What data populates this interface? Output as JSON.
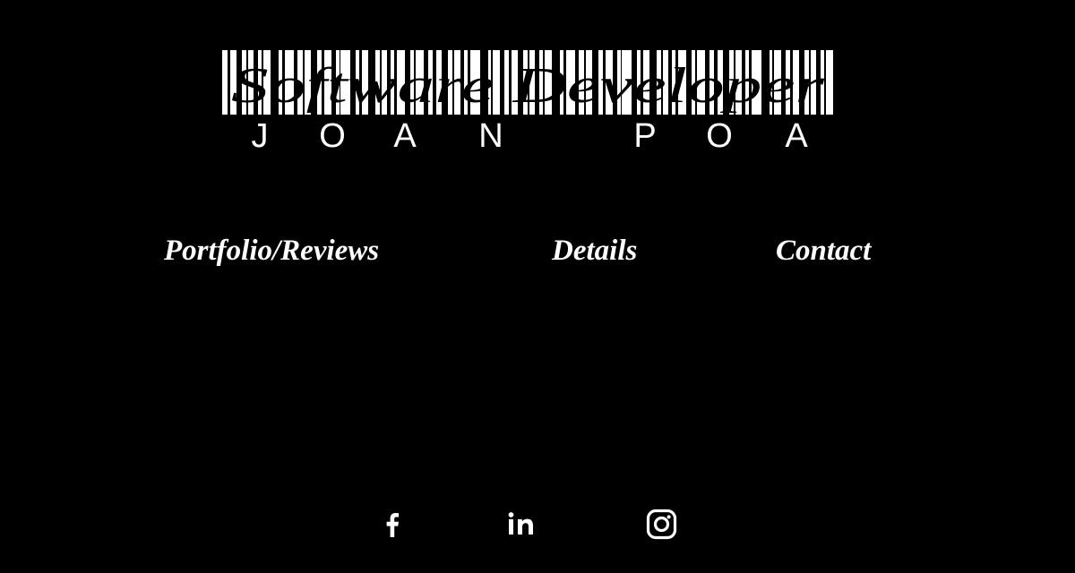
{
  "logo": {
    "tagline": "Software Developer",
    "name": "JOAN POA",
    "name_letters": [
      "J",
      "O",
      "A",
      "N",
      "P",
      "O",
      "A"
    ]
  },
  "nav": {
    "items": [
      {
        "label": "Portfolio/Reviews"
      },
      {
        "label": "Details"
      },
      {
        "label": "Contact"
      }
    ]
  },
  "social": {
    "icons": [
      "facebook-icon",
      "linkedin-icon",
      "instagram-icon"
    ]
  },
  "colors": {
    "background": "#000000",
    "text": "#ffffff"
  }
}
